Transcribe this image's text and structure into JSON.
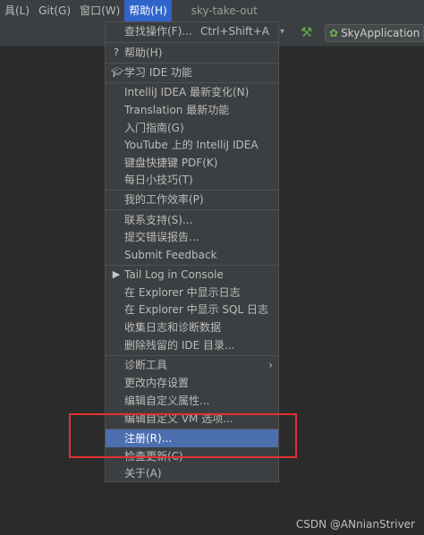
{
  "menubar": {
    "items": [
      "具(L)",
      "Git(G)",
      "窗口(W)",
      "帮助(H)"
    ],
    "project_title": "sky-take-out"
  },
  "toolbar": {
    "run_config": "SkyApplication"
  },
  "help_menu": {
    "items": [
      {
        "label": "查找操作(F)...",
        "shortcut": "Ctrl+Shift+A"
      },
      {
        "label": "帮助(H)"
      },
      {
        "label": "学习 IDE 功能"
      },
      {
        "label": "IntelliJ IDEA 最新变化(N)"
      },
      {
        "label": "Translation 最新功能"
      },
      {
        "label": "入门指南(G)"
      },
      {
        "label": "YouTube 上的 IntelliJ IDEA"
      },
      {
        "label": "键盘快捷键 PDF(K)"
      },
      {
        "label": "每日小技巧(T)"
      },
      {
        "label": "我的工作效率(P)"
      },
      {
        "label": "联系支持(S)..."
      },
      {
        "label": "提交错误报告..."
      },
      {
        "label": "Submit Feedback"
      },
      {
        "label": "Tail Log in Console"
      },
      {
        "label": "在 Explorer 中显示日志"
      },
      {
        "label": "在 Explorer 中显示 SQL 日志"
      },
      {
        "label": "收集日志和诊断数据"
      },
      {
        "label": "删除残留的 IDE 目录..."
      },
      {
        "label": "诊断工具"
      },
      {
        "label": "更改内存设置"
      },
      {
        "label": "编辑自定义属性..."
      },
      {
        "label": "编辑自定义 VM 选项..."
      },
      {
        "label": "注册(R)...",
        "selected": true
      },
      {
        "label": "检查更新(C)"
      },
      {
        "label": "关于(A)"
      }
    ]
  },
  "watermark": "CSDN @ANnianStriver",
  "colors": {
    "menu_bg": "#3c3f41",
    "selection": "#4b6eaf",
    "menubar_active": "#2f65ca",
    "highlight_box": "#e03131"
  }
}
